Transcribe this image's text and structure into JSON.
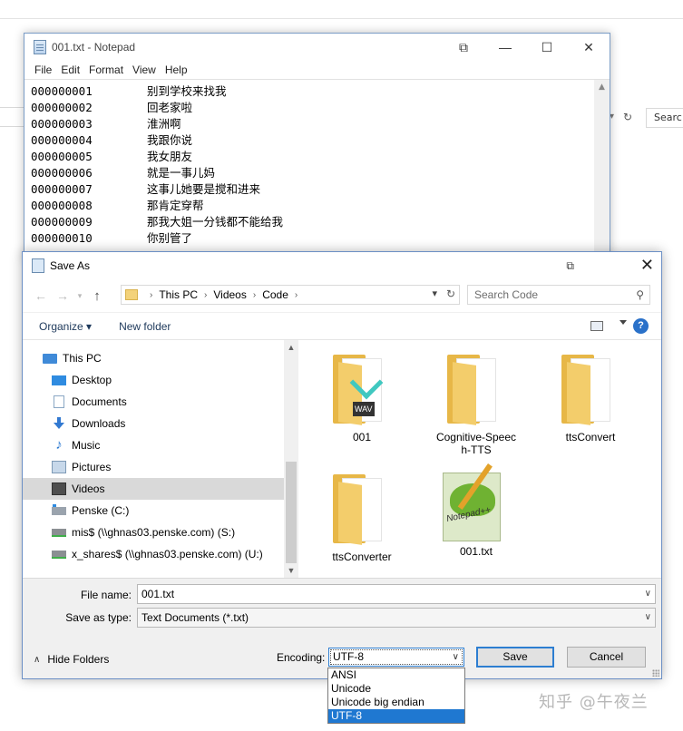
{
  "background": {
    "search_fragment": "Searc",
    "refresh_glyph": "↻"
  },
  "notepad": {
    "title": "001.txt - Notepad",
    "menu": [
      "File",
      "Edit",
      "Format",
      "View",
      "Help"
    ],
    "lines": [
      {
        "num": "000000001",
        "text": "别到学校来找我"
      },
      {
        "num": "000000002",
        "text": "回老家啦"
      },
      {
        "num": "000000003",
        "text": "淮洲啊"
      },
      {
        "num": "000000004",
        "text": "我跟你说"
      },
      {
        "num": "000000005",
        "text": "我女朋友"
      },
      {
        "num": "000000006",
        "text": "就是一事儿妈"
      },
      {
        "num": "000000007",
        "text": "这事儿她要是搅和进来"
      },
      {
        "num": "000000008",
        "text": "那肯定穿帮"
      },
      {
        "num": "000000009",
        "text": "那我大姐一分钱都不能给我"
      },
      {
        "num": "000000010",
        "text": "你别管了"
      }
    ]
  },
  "save_dialog": {
    "title": "Save As",
    "breadcrumb": [
      "This PC",
      "Videos",
      "Code"
    ],
    "search_placeholder": "Search Code",
    "toolbar": {
      "organize": "Organize ▾",
      "new_folder": "New folder",
      "help": "?"
    },
    "tree": [
      {
        "label": "This PC",
        "icon": "computer-icon"
      },
      {
        "label": "Desktop",
        "icon": "desktop-icon"
      },
      {
        "label": "Documents",
        "icon": "documents-icon"
      },
      {
        "label": "Downloads",
        "icon": "downloads-icon"
      },
      {
        "label": "Music",
        "icon": "music-icon"
      },
      {
        "label": "Pictures",
        "icon": "pictures-icon"
      },
      {
        "label": "Videos",
        "icon": "videos-icon",
        "selected": true
      },
      {
        "label": "Penske (C:)",
        "icon": "drive-icon"
      },
      {
        "label": "mis$ (\\\\ghnas03.penske.com) (S:)",
        "icon": "network-drive-icon"
      },
      {
        "label": "x_shares$ (\\\\ghnas03.penske.com) (U:)",
        "icon": "network-drive-icon"
      }
    ],
    "files": [
      {
        "name": "001",
        "type": "folder-wav",
        "wav_label": "WAV"
      },
      {
        "name": "Cognitive-Speec\nh-TTS",
        "type": "folder"
      },
      {
        "name": "ttsConvert",
        "type": "folder"
      },
      {
        "name": "ttsConverter",
        "type": "folder"
      },
      {
        "name": "001.txt",
        "type": "notepadpp-file",
        "logo_text": "Notepad++"
      }
    ],
    "file_name_label": "File name:",
    "file_name_value": "001.txt",
    "save_type_label": "Save as type:",
    "save_type_value": "Text Documents (*.txt)",
    "hide_folders": "Hide Folders",
    "encoding_label": "Encoding:",
    "encoding_value": "UTF-8",
    "save_button": "Save",
    "cancel_button": "Cancel"
  },
  "encoding_options": [
    "ANSI",
    "Unicode",
    "Unicode big endian",
    "UTF-8"
  ],
  "encoding_selected_index": 3,
  "watermark": "知乎 @午夜兰"
}
